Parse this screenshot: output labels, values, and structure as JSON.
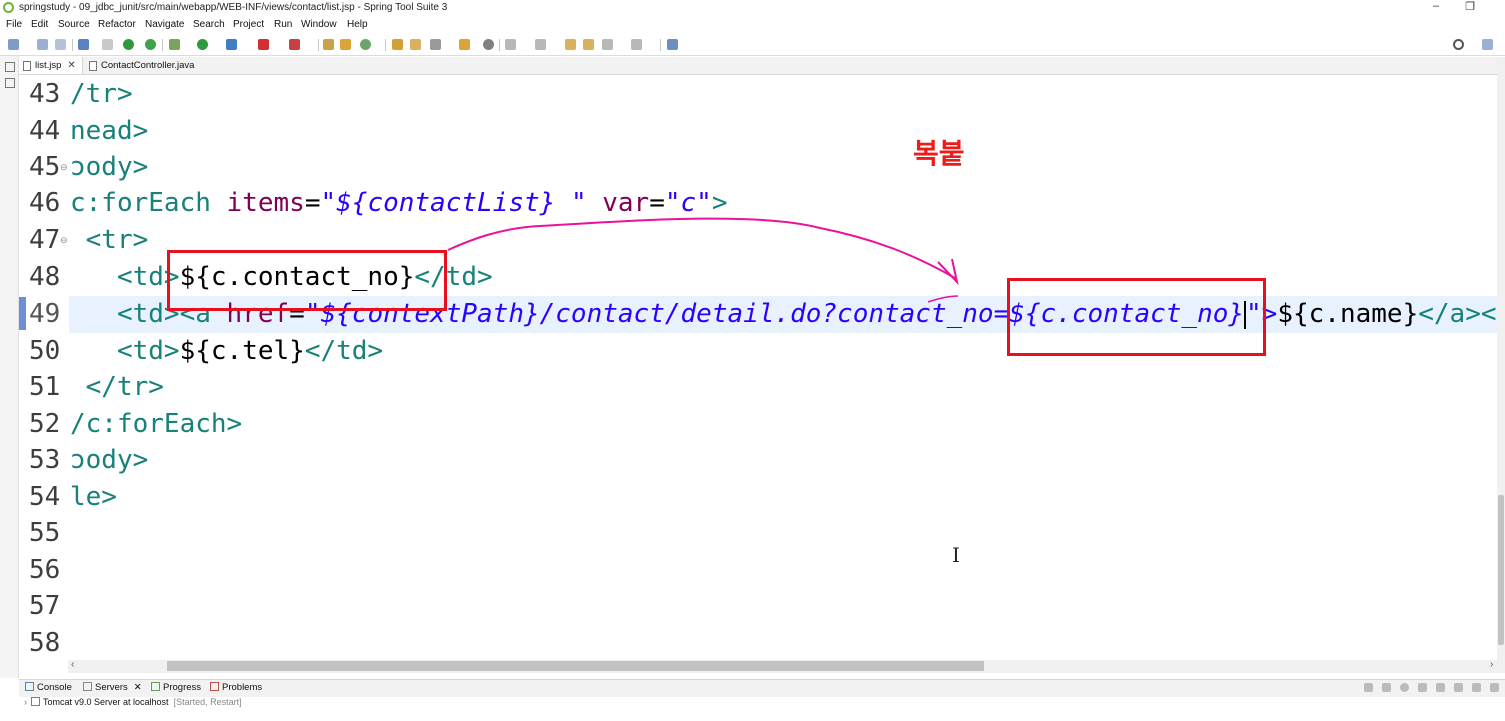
{
  "window": {
    "title": "springstudy - 09_jdbc_junit/src/main/webapp/WEB-INF/views/contact/list.jsp - Spring Tool Suite 3",
    "minimize": "–",
    "restore": "❐"
  },
  "menu": [
    "File",
    "Edit",
    "Source",
    "Refactor",
    "Navigate",
    "Search",
    "Project",
    "Run",
    "Window",
    "Help"
  ],
  "tabs": [
    {
      "label": "list.jsp",
      "close": "✕"
    },
    {
      "label": "ContactController.java"
    }
  ],
  "editor": {
    "current_line": "49",
    "lines": [
      {
        "num": "43",
        "c0": "/tr>"
      },
      {
        "num": "44",
        "c0": "nead>"
      },
      {
        "num": "45",
        "c0": "ɔody>",
        "fold": "⊖"
      },
      {
        "num": "46",
        "c0": "c:forEach ",
        "c1": "items",
        "c2": "=",
        "c3": "\"${contactList} \"",
        "c4": " var",
        "c5": "=",
        "c6": "\"c\"",
        "c7": ">"
      },
      {
        "num": "47",
        "c0": " <tr>",
        "fold": "⊖"
      },
      {
        "num": "48",
        "c0": "   <td>",
        "c1": "${c.contact_no}",
        "c2": "</td>"
      },
      {
        "num": "49",
        "c0": "   <td><a ",
        "c1": "href",
        "c2": "=",
        "c3": "\"${contextPath}/contact/detail.do?contact_no=${c.contact_no}",
        "c4": "\">",
        "c5": "${c.name}",
        "c6": "</a><"
      },
      {
        "num": "50",
        "c0": "   <td>",
        "c1": "${c.tel}",
        "c2": "</td>"
      },
      {
        "num": "51",
        "c0": " </tr>"
      },
      {
        "num": "52",
        "c0": "/c:forEach>"
      },
      {
        "num": "53",
        "c0": "ɔody>"
      },
      {
        "num": "54",
        "c0": "le>"
      },
      {
        "num": "55",
        "c0": ""
      },
      {
        "num": "56",
        "c0": ""
      },
      {
        "num": "57",
        "c0": ""
      },
      {
        "num": "58",
        "c0": ""
      }
    ]
  },
  "annotation": {
    "note": "복붙",
    "color": "#e8101e",
    "arrow_color": "#e8129b"
  },
  "bottom_panel": {
    "tabs": [
      "Console",
      "Servers",
      "Progress",
      "Problems"
    ],
    "servers_close": "✕",
    "server_name": "Tomcat v9.0 Server at localhost",
    "server_status": "[Started, Restart]"
  }
}
